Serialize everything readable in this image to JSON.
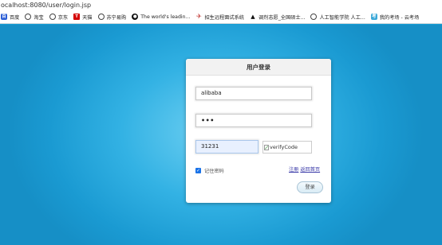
{
  "browser": {
    "url": "ocalhost:8080/user/login.jsp",
    "bookmarks": [
      {
        "icon": "baidu-icon",
        "label": "百度"
      },
      {
        "icon": "globe-icon",
        "label": "淘宝"
      },
      {
        "icon": "globe-icon",
        "label": "京东"
      },
      {
        "icon": "tmall-icon",
        "label": "天猫"
      },
      {
        "icon": "globe-icon",
        "label": "苏宁易购"
      },
      {
        "icon": "github-icon",
        "label": "The world's leadin..."
      },
      {
        "icon": "rocket-icon",
        "label": "招生远程面试系统"
      },
      {
        "icon": "graduation-cap-icon",
        "label": "调剂志愿_全国硕士..."
      },
      {
        "icon": "globe-icon",
        "label": "人工智能学院 人工..."
      },
      {
        "icon": "exam-icon",
        "label": "我的考场 - 云考场"
      }
    ]
  },
  "login": {
    "title": "用户登录",
    "username": "alibaba",
    "password": "•••",
    "verify_code": "31231",
    "verify_image_alt": "verifyCode",
    "remember_label": "记住密码",
    "register_link": "注册",
    "home_link": "返回首页",
    "submit_label": "登录"
  }
}
